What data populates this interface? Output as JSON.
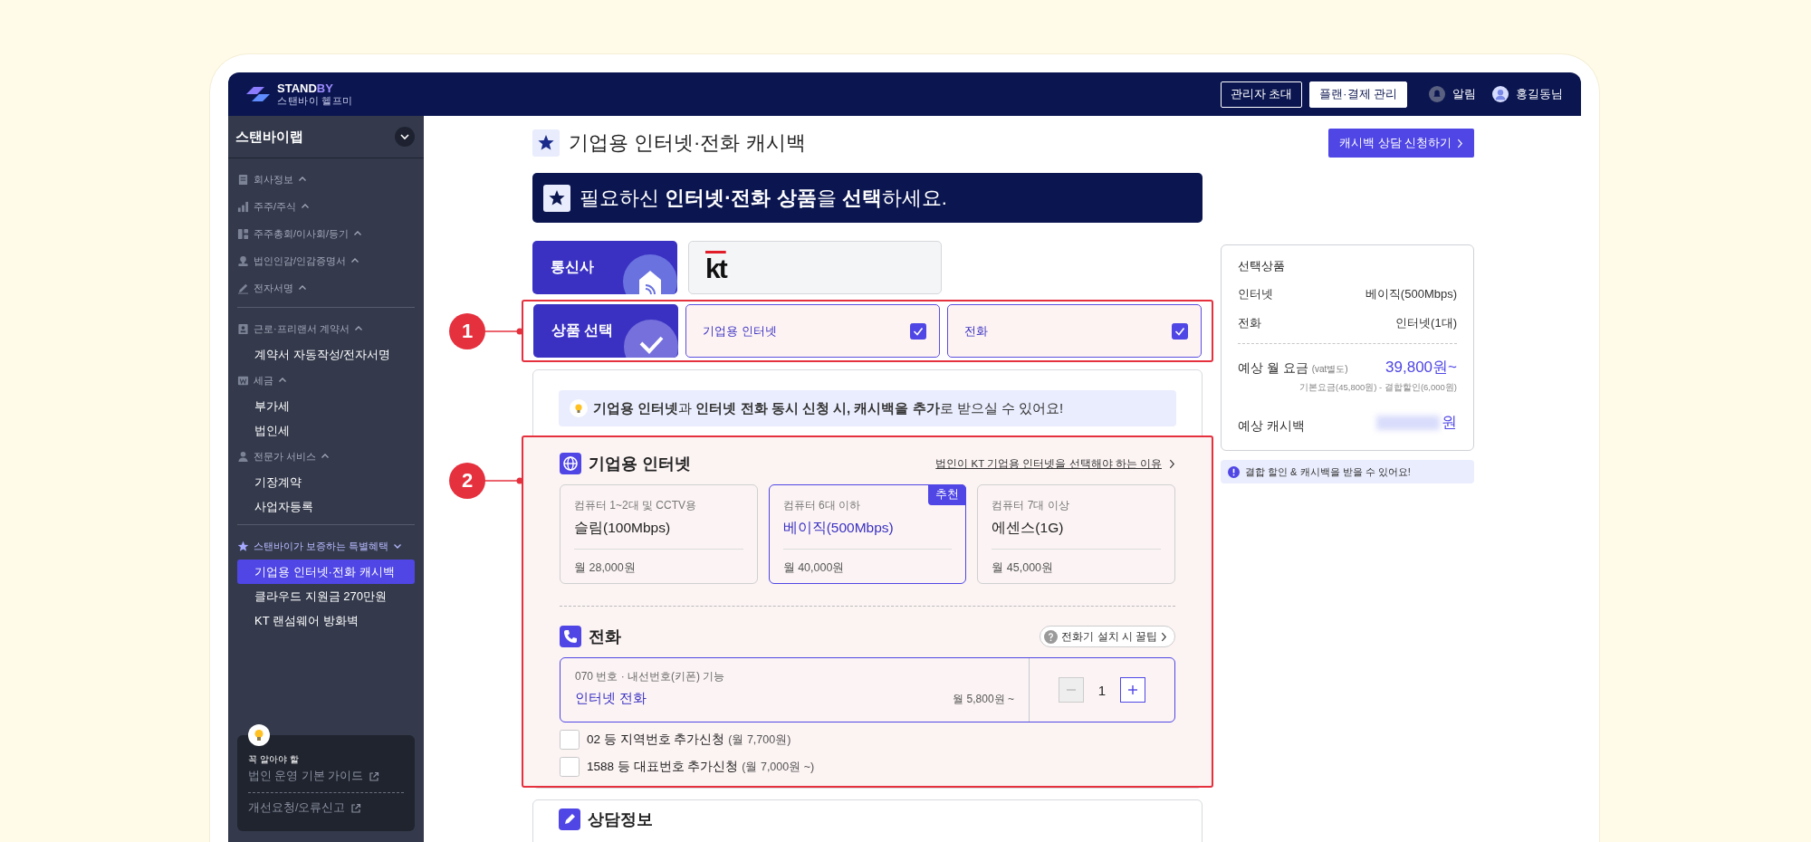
{
  "header": {
    "logo": {
      "main": "STAND",
      "accent": "BY",
      "subtitle": "스탠바이 헬프미"
    },
    "buttons": [
      {
        "label": "관리자 초대",
        "kind": "outline"
      },
      {
        "label": "플랜·결제 관리",
        "kind": "filled"
      }
    ],
    "notifications": "알림",
    "user": "홍길동님"
  },
  "sidebar": {
    "workspace": "스탠바이랩",
    "sections": [
      {
        "groups": [
          {
            "label": "회사정보",
            "kind": "normal"
          },
          {
            "label": "주주/주식",
            "kind": "normal"
          },
          {
            "label": "주주총회/이사회/등기",
            "kind": "normal"
          },
          {
            "label": "법인인감/인감증명서",
            "kind": "normal"
          },
          {
            "label": "전자서명",
            "kind": "normal"
          }
        ]
      },
      {
        "groups": [
          {
            "label": "근로·프리랜서 계약서",
            "kind": "normal",
            "items": [
              {
                "label": "계약서 자동작성/전자서명",
                "selected": false
              }
            ]
          },
          {
            "label": "세금",
            "kind": "normal",
            "items": [
              {
                "label": "부가세",
                "selected": false
              },
              {
                "label": "법인세",
                "selected": false
              }
            ]
          },
          {
            "label": "전문가 서비스",
            "kind": "normal",
            "items": [
              {
                "label": "기장계약",
                "selected": false
              },
              {
                "label": "사업자등록",
                "selected": false
              }
            ]
          }
        ]
      },
      {
        "groups": [
          {
            "label": "스탠바이가 보증하는 특별혜택",
            "kind": "featured",
            "items": [
              {
                "label": "기업용 인터넷·전화 캐시백",
                "selected": true
              },
              {
                "label": "클라우드 지원금 270만원",
                "selected": false
              },
              {
                "label": "KT 랜섬웨어 방화벽",
                "selected": false
              }
            ]
          }
        ]
      }
    ],
    "help": {
      "caption": "꼭 알아야 할",
      "links": [
        "법인 운영 기본 가이드",
        "개선요청/오류신고"
      ]
    }
  },
  "main": {
    "title": "기업용 인터넷·전화 캐시백",
    "cta": "캐시백 상담 신청하기",
    "banner": "필요하신 **인터넷·전화 상품**을 **선택**하세요.",
    "carrier": {
      "step": "통신사",
      "value": "kt"
    },
    "products": {
      "step": "상품 선택",
      "options": [
        {
          "label": "기업용 인터넷",
          "checked": true
        },
        {
          "label": "전화",
          "checked": true
        }
      ]
    },
    "notice": "**기업용 인터넷**과 **인터넷 전화 동시 신청 시, 캐시백을 추가**로 받으실 수 있어요!",
    "internet": {
      "title": "기업용 인터넷",
      "link": "법인이 KT 기업용 인터넷을 선택해야 하는 이유",
      "plans": [
        {
          "description": "컴퓨터 1~2대 및 CCTV용",
          "name": "슬림(100Mbps)",
          "price": "월 28,000원",
          "selected": false
        },
        {
          "description": "컴퓨터 6대 이하",
          "name": "베이직(500Mbps)",
          "price": "월 40,000원",
          "selected": true,
          "badge": "추천"
        },
        {
          "description": "컴퓨터 7대 이상",
          "name": "에센스(1G)",
          "price": "월 45,000원",
          "selected": false
        }
      ]
    },
    "phone": {
      "title": "전화",
      "tip": "전화기 설치 시 꿀팁",
      "option": {
        "description": "070 번호 · 내선번호(키폰) 기능",
        "name": "인터넷 전화",
        "price": "월 5,800원 ~",
        "quantity": "1",
        "minus_disabled": true
      },
      "addons": [
        {
          "label": "02 등 지역번호 추가신청",
          "note": "(월 7,700원)",
          "checked": false
        },
        {
          "label": "1588 등 대표번호 추가신청",
          "note": "(월 7,000원 ~)",
          "checked": false
        }
      ]
    },
    "next_section": "상담정보"
  },
  "summary": {
    "title": "선택상품",
    "rows": [
      {
        "label": "인터넷",
        "value": "베이직(500Mbps)"
      },
      {
        "label": "전화",
        "value": "인터넷(1대)"
      }
    ],
    "monthly": {
      "label": "예상 월 요금",
      "note": "(vat별도)",
      "value": "39,800원~",
      "breakdown": "기본요금(45,800원) - 결합할인(6,000원)"
    },
    "cashback": {
      "label": "예상 캐시백",
      "unit": "원"
    },
    "alert": "결합 할인 & 캐시백을 받을 수 있어요!"
  },
  "annotations": [
    "1",
    "2"
  ]
}
